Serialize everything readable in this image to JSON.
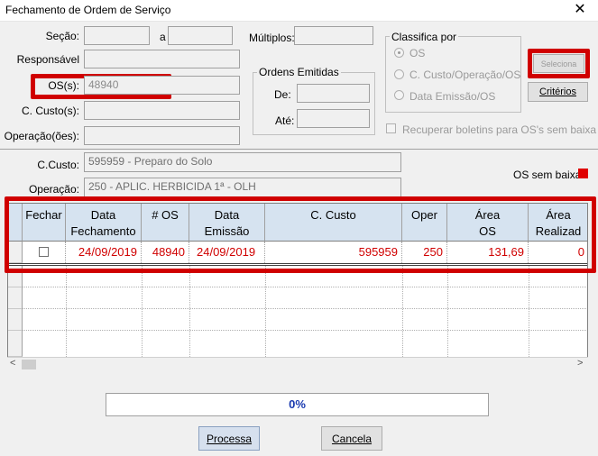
{
  "window": {
    "title": "Fechamento de Ordem de Serviço",
    "close_glyph": "✕"
  },
  "filters": {
    "secao_label": "Seção:",
    "a_label": "a",
    "multiplos_label": "Múltiplos:",
    "responsavel_label": "Responsável",
    "os_label": "OS(s):",
    "os_value": "48940",
    "ccusto_label": "C. Custo(s):",
    "operacao_label": "Operação(ões):"
  },
  "ordens_emitidas": {
    "title": "Ordens Emitidas",
    "de_label": "De:",
    "ate_label": "Até:"
  },
  "classifica": {
    "title": "Classifica por",
    "options": [
      "OS",
      "C. Custo/Operação/OS",
      "Data Emissão/OS"
    ],
    "selected": "OS"
  },
  "buttons": {
    "seleciona": "Seleciona",
    "criterios": "Critérios",
    "processa": "Processa",
    "cancela": "Cancela"
  },
  "recuperar_label": "Recuperar boletins para OS's sem baixa",
  "details": {
    "ccusto_label": "C.Custo:",
    "ccusto_value": "595959 - Preparo do Solo",
    "operacao_label": "Operação:",
    "operacao_value": "250 - APLIC. HERBICIDA 1ª - OLH",
    "legend_label": "OS sem baixa",
    "legend_color": "#e00000"
  },
  "grid": {
    "columns": [
      {
        "l1": "Fechar",
        "l2": ""
      },
      {
        "l1": "Data",
        "l2": "Fechamento"
      },
      {
        "l1": "# OS",
        "l2": ""
      },
      {
        "l1": "Data",
        "l2": "Emissão"
      },
      {
        "l1": "C. Custo",
        "l2": ""
      },
      {
        "l1": "Oper",
        "l2": ""
      },
      {
        "l1": "Área",
        "l2": "OS"
      },
      {
        "l1": "Área",
        "l2": "Realizad"
      }
    ],
    "rows": [
      {
        "data_fechamento": "24/09/2019",
        "os": "48940",
        "data_emissao": "24/09/2019",
        "ccusto": "595959",
        "oper": "250",
        "area_os": "131,69",
        "area_realizada": "0"
      }
    ]
  },
  "scroll": {
    "left_arrow": "<",
    "right_arrow": ">"
  },
  "progress": {
    "text": "0%",
    "value": 0
  },
  "accent_red": "#d00000"
}
